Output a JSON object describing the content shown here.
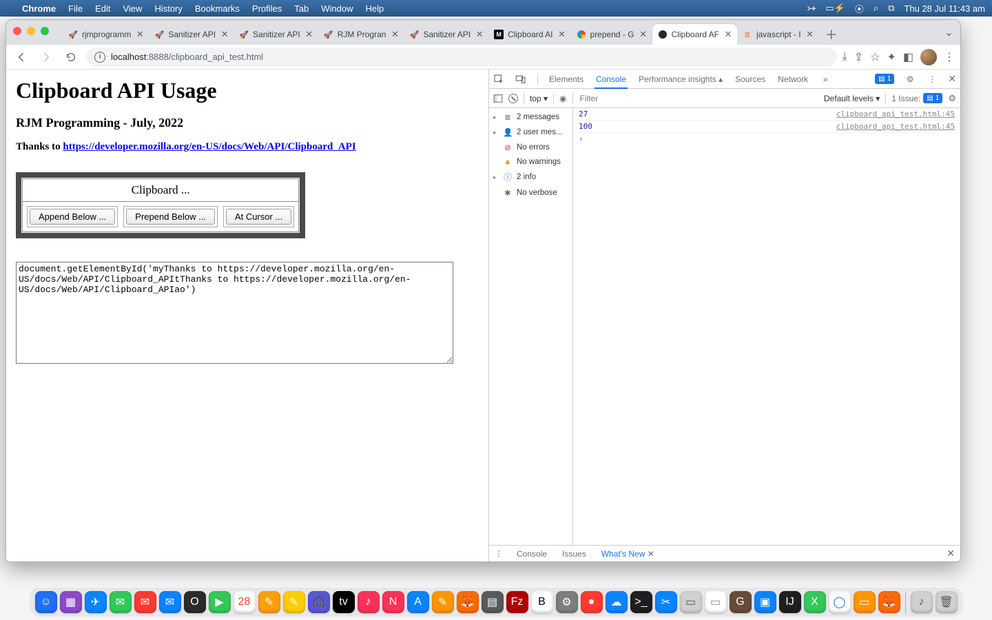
{
  "menubar": {
    "app": "Chrome",
    "items": [
      "File",
      "Edit",
      "View",
      "History",
      "Bookmarks",
      "Profiles",
      "Tab",
      "Window",
      "Help"
    ],
    "clock": "Thu 28 Jul  11:43 am"
  },
  "tabs": [
    {
      "label": "rjmprogramm",
      "favicon": "rocket"
    },
    {
      "label": "Sanitizer API",
      "favicon": "rocket"
    },
    {
      "label": "Sanitizer API",
      "favicon": "rocket"
    },
    {
      "label": "RJM Progran",
      "favicon": "rocket"
    },
    {
      "label": "Sanitizer API",
      "favicon": "rocket"
    },
    {
      "label": "Clipboard AI",
      "favicon": "mdn"
    },
    {
      "label": "prepend - G",
      "favicon": "google"
    },
    {
      "label": "Clipboard AF",
      "favicon": "github",
      "active": true
    },
    {
      "label": "javascript - I",
      "favicon": "so"
    }
  ],
  "omnibox": {
    "host": "localhost",
    "port": ":8888",
    "path": "/clipboard_api_test.html"
  },
  "page": {
    "h1": "Clipboard API Usage",
    "h2": "RJM Programming - July, 2022",
    "thanks_prefix": "Thanks to ",
    "thanks_link": "https://developer.mozilla.org/en-US/docs/Web/API/Clipboard_API",
    "table_title": "Clipboard ...",
    "btn_append": "Append Below ...",
    "btn_prepend": "Prepend Below ...",
    "btn_cursor": "At Cursor ...",
    "textarea": "document.getElementById('myThanks to https://developer.mozilla.org/en-US/docs/Web/API/Clipboard_APItThanks to https://developer.mozilla.org/en-US/docs/Web/API/Clipboard_APIao')"
  },
  "devtools": {
    "tabs": [
      "Elements",
      "Console",
      "Performance insights",
      "Sources",
      "Network"
    ],
    "active_tab": "Console",
    "badge": "1",
    "toolbar": {
      "scope": "top ▾",
      "filter_ph": "Filter",
      "levels": "Default levels ▾",
      "issues_label": "1 Issue:",
      "issues_badge": "1"
    },
    "sidebar": [
      {
        "tri": "▸",
        "icon": "msg",
        "label": "2 messages"
      },
      {
        "tri": "▸",
        "icon": "user",
        "label": "2 user mes..."
      },
      {
        "tri": "",
        "icon": "err",
        "label": "No errors"
      },
      {
        "tri": "",
        "icon": "warn",
        "label": "No warnings"
      },
      {
        "tri": "▸",
        "icon": "info",
        "label": "2 info"
      },
      {
        "tri": "",
        "icon": "verb",
        "label": "No verbose"
      }
    ],
    "console_lines": [
      {
        "val": "27",
        "src": "clipboard_api_test.html:45"
      },
      {
        "val": "100",
        "src": "clipboard_api_test.html:45"
      }
    ],
    "drawer": {
      "tabs": [
        "Console",
        "Issues",
        "What's New"
      ],
      "active": "What's New"
    }
  },
  "dock_apps": [
    {
      "c": "#1e6ff2",
      "t": "☺"
    },
    {
      "c": "#8d49c7",
      "t": "▦"
    },
    {
      "c": "#0b84ff",
      "t": "✈"
    },
    {
      "c": "#34c759",
      "t": "✉"
    },
    {
      "c": "#ff3b30",
      "t": "✉"
    },
    {
      "c": "#0a84ff",
      "t": "✉"
    },
    {
      "c": "#2b2b2b",
      "t": "O"
    },
    {
      "c": "#34c759",
      "t": "▶"
    },
    {
      "c": "#ffffff",
      "t": "28",
      "fg": "#ff3b30"
    },
    {
      "c": "#ff9f0a",
      "t": "✎"
    },
    {
      "c": "#ffcc00",
      "t": "✎"
    },
    {
      "c": "#5856d6",
      "t": "🎧"
    },
    {
      "c": "#000",
      "t": "tv"
    },
    {
      "c": "#fc3158",
      "t": "♪"
    },
    {
      "c": "#fc3158",
      "t": "N"
    },
    {
      "c": "#0a84ff",
      "t": "A"
    },
    {
      "c": "#ff9500",
      "t": "✎"
    },
    {
      "c": "#ff6a00",
      "t": "🦊"
    },
    {
      "c": "#5a5a5a",
      "t": "▤"
    },
    {
      "c": "#b30000",
      "t": "Fz"
    },
    {
      "c": "#fff",
      "t": "B",
      "fg": "#000"
    },
    {
      "c": "#7d7d7d",
      "t": "⚙"
    },
    {
      "c": "#ff3b30",
      "t": "●"
    },
    {
      "c": "#0a84ff",
      "t": "☁"
    },
    {
      "c": "#1f1f1f",
      "t": ">_"
    },
    {
      "c": "#0a84ff",
      "t": "✂"
    },
    {
      "c": "#d0d0d0",
      "t": "▭",
      "fg": "#555"
    },
    {
      "c": "#ffffff",
      "t": "▭",
      "fg": "#888"
    },
    {
      "c": "#6a4a3a",
      "t": "G"
    },
    {
      "c": "#0a84ff",
      "t": "▣"
    },
    {
      "c": "#1f1f1f",
      "t": "IJ"
    },
    {
      "c": "#34c759",
      "t": "X"
    },
    {
      "c": "#fff",
      "t": "◯",
      "fg": "#1a73e8"
    },
    {
      "c": "#ff9500",
      "t": "▭"
    },
    {
      "c": "#ff6a00",
      "t": "🦊"
    }
  ],
  "dock_right": [
    {
      "c": "#d0d0d0",
      "t": "♪",
      "fg": "#555"
    },
    {
      "c": "#d0d0d0",
      "t": "🗑",
      "fg": "#555"
    }
  ]
}
